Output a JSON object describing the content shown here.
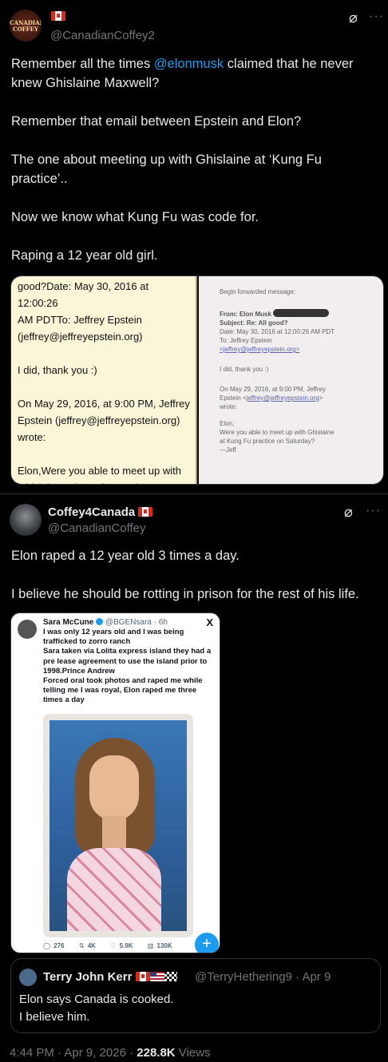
{
  "post1": {
    "handle": "@CanadianCoffey2",
    "avatar_text": "CANADIAN COFFEY",
    "body_pre": "Remember all the times ",
    "mention": "@elonmusk",
    "body_post": " claimed that he never knew Ghislaine Maxwell?\n\nRemember that email between Epstein and Elon?\n\nThe one about meeting up with Ghislaine at ‘Kung Fu practice’..\n\nNow we know what Kung Fu was code for.\n\nRaping a 12 year old girl.",
    "media_left": "good?Date: May 30, 2016 at 12:00:26\nAM PDTTo: Jeffrey Epstein\n(jeffrey@jeffreyepstein.org)\n\nI did, thank you :)\n\nOn May 29, 2016, at 9:00 PM, Jeffrey\nEpstein (jeffrey@jeffreyepstein.org)\nwrote:\n\nElon,Were you able to meet up with\nGhislaine at kung fu practice on\nSaturday?",
    "media_right": {
      "forwarded": "Begin forwarded message:",
      "from": "From: Elon Musk",
      "subject": "Subject: Re: All good?",
      "date": "Date: May 30, 2016 at 12:00:26 AM PDT",
      "to": "To: Jeffrey Epstein",
      "to_email": "<jeffrey@jeffreyepstein.org>",
      "reply": "I did, thank you :)",
      "on_line": "On May 29, 2016, at 9:00 PM, Jeffrey\nEpstein <",
      "on_email": "jeffrey@jeffreyepstein.org",
      "on_end": ">\nwrote:",
      "msg": "Elon,\nWere you able to meet up with Ghislaine\nat Kung Fu practice on Saturday?\n—Jeff"
    }
  },
  "post2": {
    "name": "Coffey4Canada",
    "handle": "@CanadianCoffey",
    "body": "Elon raped a 12 year old 3 times a day.\n\nI believe he should be rotting in prison for the rest of his life.",
    "embed": {
      "name": "Sara McCune",
      "handle": "@BGENsara · 6h",
      "x_label": "X",
      "text": "I was only 12 years old and I was being trafficked to zorro ranch\nSara taken via Lolita express island they had a pre lease agreement to use the island prior to 1998.Prince Andrew\nForced oral took photos and raped me while telling me I was royal, Elon raped me three times a day",
      "stats": [
        "276",
        "4K",
        "5.9K",
        "130K"
      ],
      "fab": "+"
    },
    "quote": {
      "name": "Terry John Kerr",
      "handle": "@TerryHethering9 · Apr 9",
      "text": "Elon says Canada is cooked.\nI believe him."
    },
    "footer": {
      "time": "4:44 PM · Apr 9, 2026 · ",
      "views": "228.8K",
      "views_label": " Views"
    }
  },
  "icons": [
    "grok-icon",
    "more-icon",
    "ca-flag-icon",
    "us-flag-icon",
    "checkered-flag-icon",
    "verified-icon",
    "reply-icon",
    "repost-icon",
    "like-icon",
    "views-icon"
  ],
  "colors": {
    "accent": "#1d9bf0",
    "background": "#000000",
    "text": "#e7e9ea",
    "muted": "#71767b"
  }
}
